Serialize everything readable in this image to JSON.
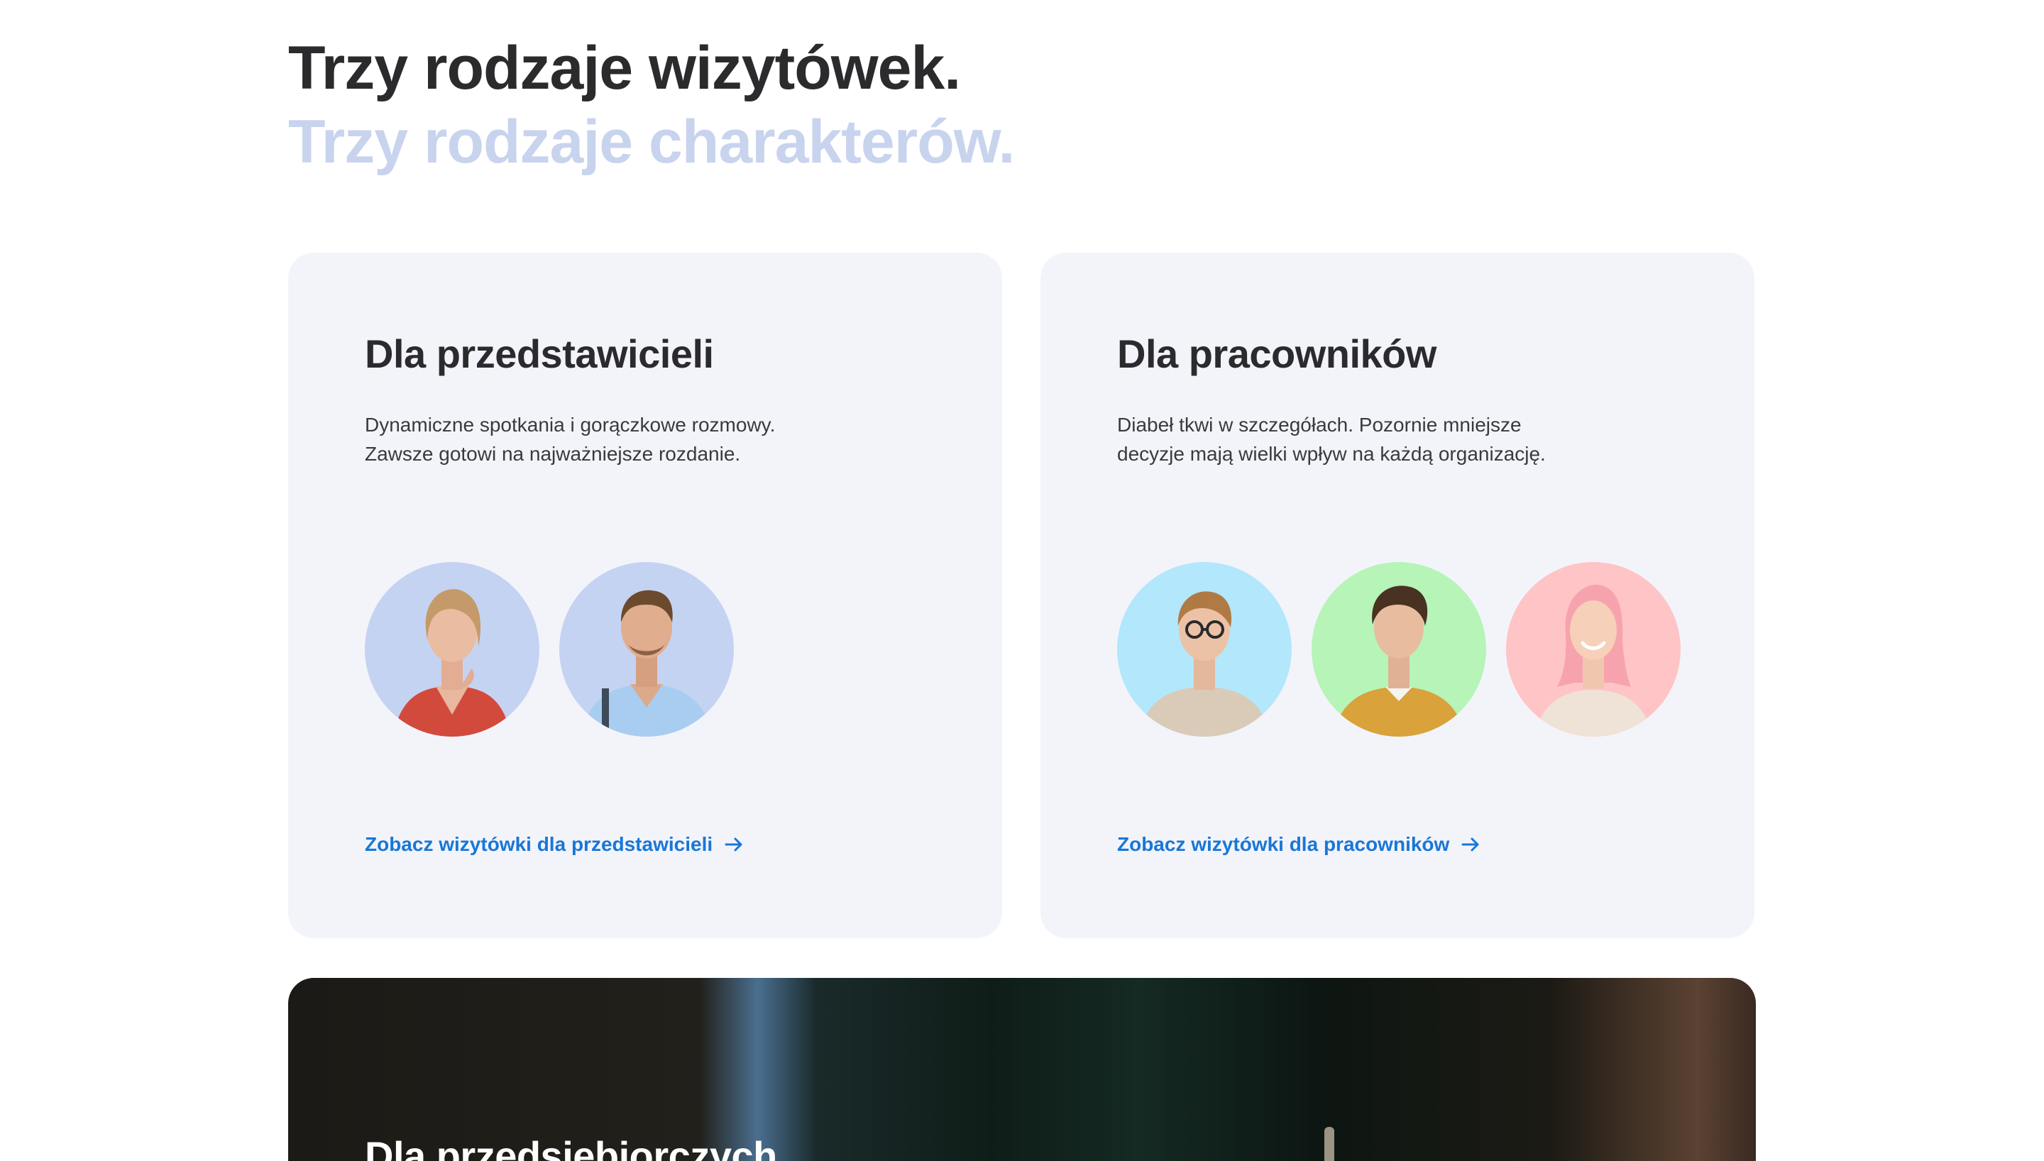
{
  "heading": {
    "title": "Trzy rodzaje wizytówek.",
    "subtitle": "Trzy rodzaje charakterów."
  },
  "cards": [
    {
      "title": "Dla przedstawicieli",
      "description": [
        "Dynamiczne spotkania i gorączkowe rozmowy.",
        "Zawsze gotowi na najważniejsze rozdanie."
      ],
      "link": "Zobacz wizytówki dla przedstawicieli",
      "avatar_bg": [
        "#c5d3f2",
        "#c5d3f2"
      ]
    },
    {
      "title": "Dla pracowników",
      "description": [
        "Diabeł tkwi w szczegółach. Pozornie mniejsze",
        "decyzje mają wielki wpływ na każdą organizację."
      ],
      "link": "Zobacz wizytówki dla pracowników",
      "avatar_bg": [
        "#b3e7fb",
        "#b6f4b8",
        "#ffc4c6"
      ]
    }
  ],
  "banner": {
    "title": "Dla przedsiębiorczych"
  },
  "colors": {
    "accent": "#1877d8",
    "subtitle": "#c8d3ee",
    "card_bg": "#f3f4fa"
  },
  "icons": {
    "link_arrow": "arrow-right-icon"
  }
}
